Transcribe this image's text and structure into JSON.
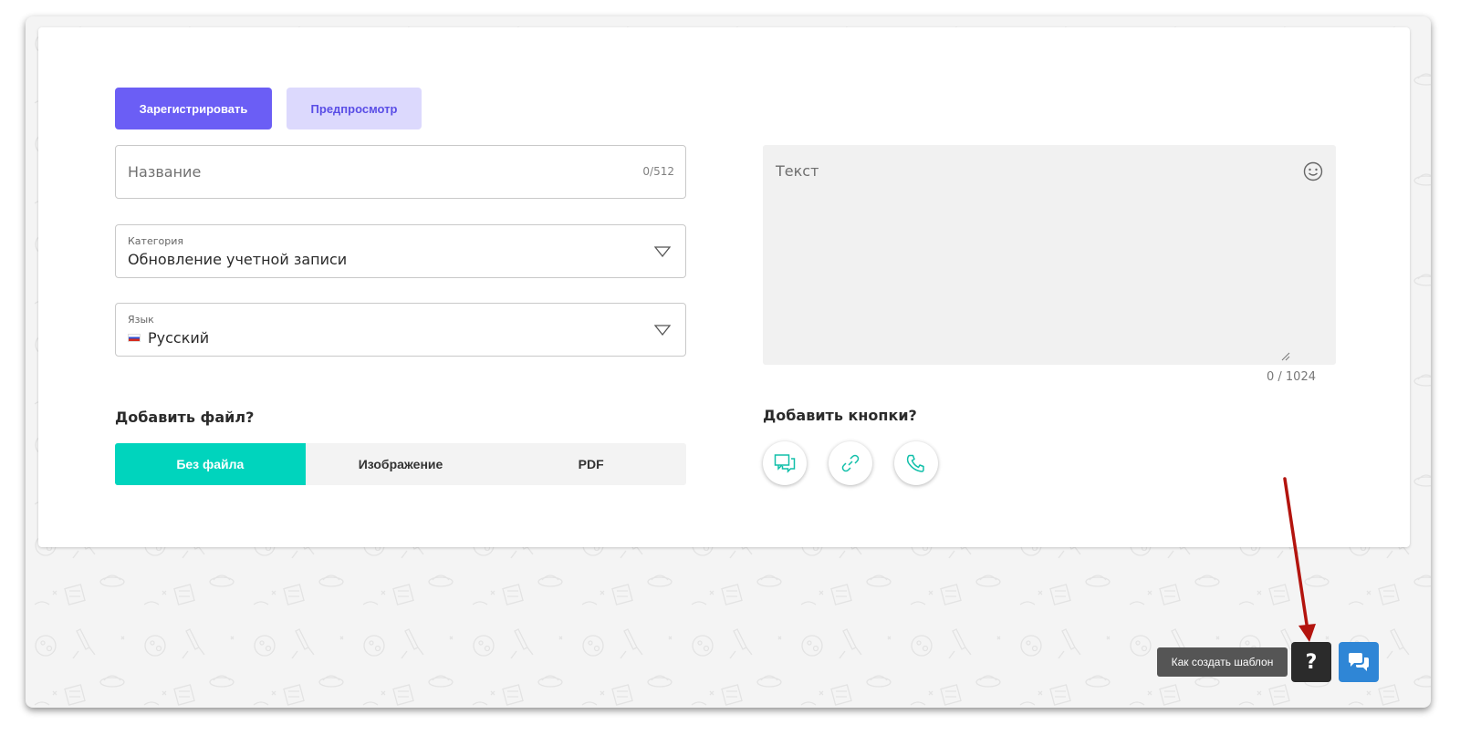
{
  "actions": {
    "register_label": "Зарегистрировать",
    "preview_label": "Предпросмотр"
  },
  "name_field": {
    "placeholder": "Название",
    "counter": "0/512"
  },
  "category_field": {
    "label": "Категория",
    "value": "Обновление учетной записи"
  },
  "language_field": {
    "label": "Язык",
    "value": "Русский"
  },
  "file_section": {
    "title": "Добавить файл?",
    "options": [
      "Без файла",
      "Изображение",
      "PDF"
    ],
    "selected": "Без файла"
  },
  "text_field": {
    "placeholder": "Текст",
    "counter": "0 / 1024"
  },
  "buttons_section": {
    "title": "Добавить кнопки?",
    "icons": [
      "chat-icon",
      "link-icon",
      "phone-icon"
    ]
  },
  "help": {
    "tooltip": "Как создать шаблон",
    "button_label": "?"
  },
  "colors": {
    "primary": "#6b5ef5",
    "primary_light": "#dcd9fd",
    "accent_teal": "#00d4bd",
    "annotation_arrow": "#b3140e",
    "chat_blue": "#2f86d6"
  }
}
